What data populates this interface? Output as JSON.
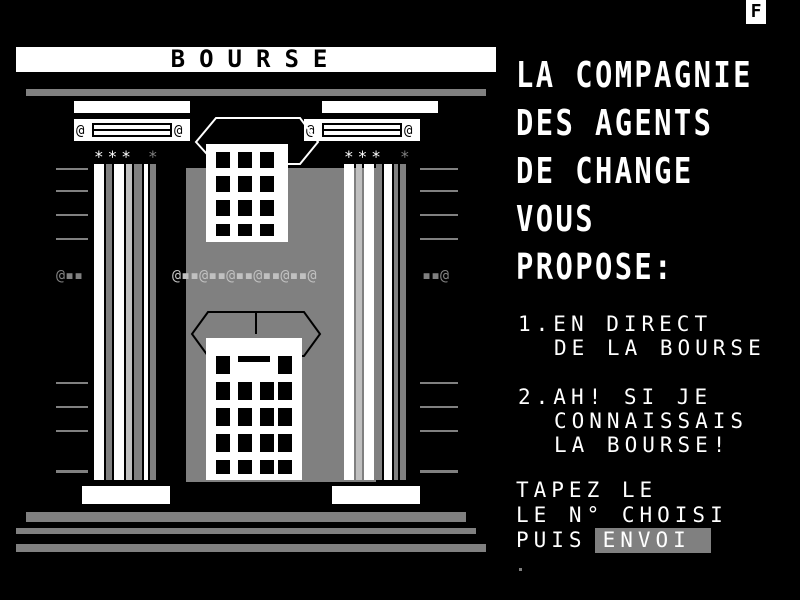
{
  "status": {
    "indicator": "F"
  },
  "banner": {
    "title": "BOURSE"
  },
  "headline": [
    "LA COMPAGNIE",
    "DES AGENTS",
    "DE CHANGE",
    "VOUS",
    "PROPOSE:"
  ],
  "menu": {
    "item1": {
      "number": "1.",
      "line1": "EN DIRECT",
      "line2": "DE LA BOURSE"
    },
    "item2": {
      "number": "2.",
      "line1": "AH! SI JE",
      "line2": "CONNAISSAIS",
      "line3": "LA BOURSE!"
    }
  },
  "prompt": {
    "line1": "TAPEZ LE",
    "line2": "LE N° CHOISI",
    "line3_prefix": "PUIS",
    "key_label": "ENVOI"
  },
  "colors": {
    "background": "#000000",
    "foreground": "#ffffff",
    "gray": "#808080",
    "light_gray": "#c0c0c0"
  }
}
